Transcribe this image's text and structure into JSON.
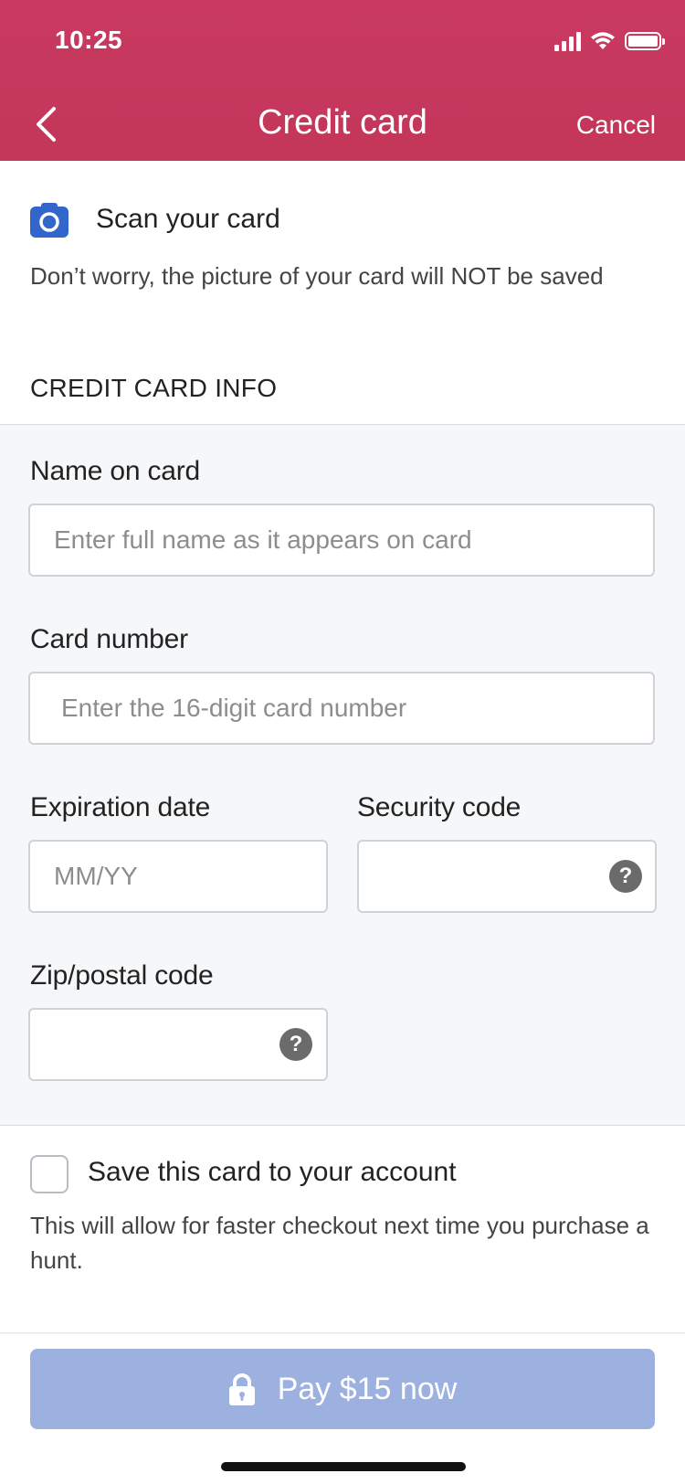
{
  "status_bar": {
    "time": "10:25"
  },
  "nav": {
    "title": "Credit card",
    "cancel_label": "Cancel"
  },
  "scan": {
    "label": "Scan your card",
    "note": "Don’t worry, the picture of your card will NOT be saved"
  },
  "section": {
    "title": "CREDIT CARD INFO"
  },
  "form": {
    "name": {
      "label": "Name on card",
      "placeholder": "Enter full name as it appears on card",
      "value": ""
    },
    "number": {
      "label": "Card number",
      "placeholder": "Enter the 16-digit card number",
      "value": ""
    },
    "expiration": {
      "label": "Expiration date",
      "placeholder": "MM/YY",
      "value": ""
    },
    "security": {
      "label": "Security code",
      "placeholder": "",
      "value": "",
      "help_glyph": "?"
    },
    "zip": {
      "label": "Zip/postal code",
      "placeholder": "",
      "value": "",
      "help_glyph": "?"
    }
  },
  "save_card": {
    "label": "Save this card to your account",
    "note": "This will allow for faster checkout next time you purchase a hunt.",
    "checked": false
  },
  "pay": {
    "label": "Pay $15 now"
  },
  "colors": {
    "header": "#c53a5e",
    "accent_blue": "#3366cc",
    "pay_button_disabled": "#9db1e1"
  },
  "icons": [
    "back-chevron-icon",
    "camera-icon",
    "help-icon",
    "lock-icon",
    "signal-icon",
    "wifi-icon",
    "battery-icon"
  ]
}
